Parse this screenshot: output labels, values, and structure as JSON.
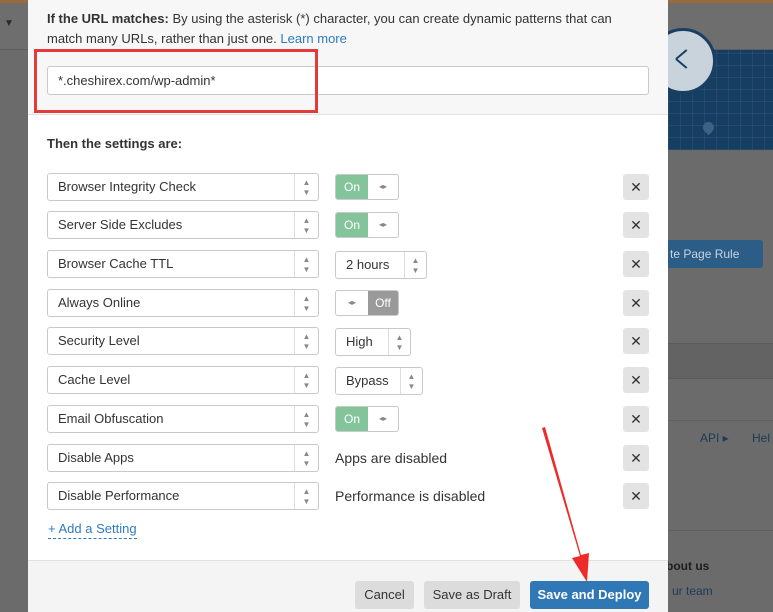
{
  "background": {
    "create_page_rule_label": "te Page Rule",
    "api_link": "API ▸",
    "help_link": "Hel",
    "about_heading": "bout us",
    "team_link": "ur team"
  },
  "url_section": {
    "lead": "If the URL matches:",
    "description": " By using the asterisk (*) character, you can create dynamic patterns that can match many URLs, rather than just one. ",
    "learn_more": "Learn more",
    "pattern_value": "*.cheshirex.com/wp-admin*"
  },
  "settings_heading": "Then the settings are:",
  "settings": [
    {
      "name": "Browser Integrity Check",
      "control": "toggle",
      "state": "On"
    },
    {
      "name": "Server Side Excludes",
      "control": "toggle",
      "state": "On"
    },
    {
      "name": "Browser Cache TTL",
      "control": "select",
      "value": "2 hours"
    },
    {
      "name": "Always Online",
      "control": "toggle",
      "state": "Off"
    },
    {
      "name": "Security Level",
      "control": "select",
      "value": "High"
    },
    {
      "name": "Cache Level",
      "control": "select",
      "value": "Bypass"
    },
    {
      "name": "Email Obfuscation",
      "control": "toggle",
      "state": "On"
    },
    {
      "name": "Disable Apps",
      "control": "text",
      "value": "Apps are disabled"
    },
    {
      "name": "Disable Performance",
      "control": "text",
      "value": "Performance is disabled"
    }
  ],
  "add_setting_label": "+ Add a Setting",
  "footer": {
    "cancel_label": "Cancel",
    "draft_label": "Save as Draft",
    "deploy_label": "Save and Deploy"
  },
  "colors": {
    "toggle_on": "#83c49b",
    "toggle_off": "#9a9a9a",
    "primary": "#2f78b5",
    "annotation_red": "#e53a3a"
  }
}
